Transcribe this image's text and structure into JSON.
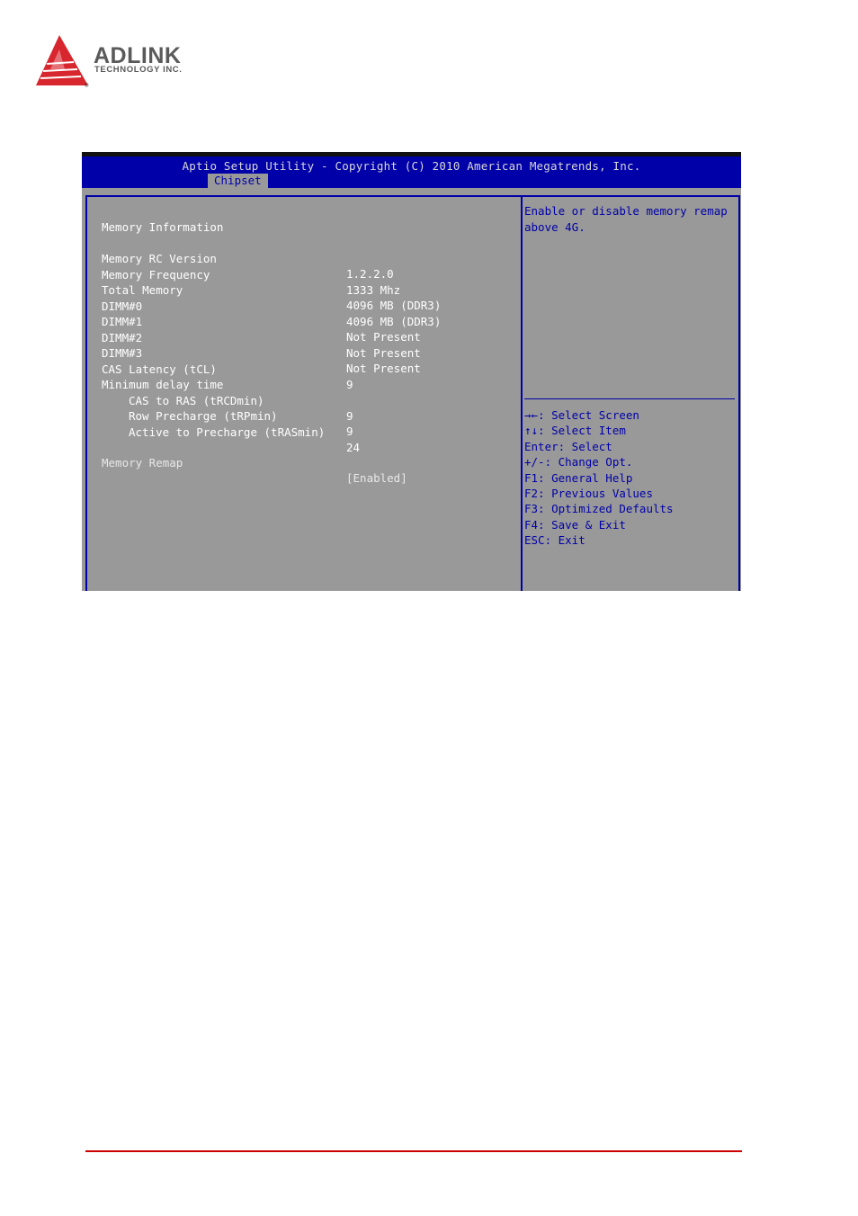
{
  "logo": {
    "name": "ADLINK",
    "subtitle": "TECHNOLOGY INC.",
    "registered": "®",
    "brand_color": "#d7262e"
  },
  "bios": {
    "title": "Aptio Setup Utility - Copyright (C) 2010 American Megatrends, Inc.",
    "active_tab": "Chipset",
    "colors": {
      "header": "#0000a8",
      "panel": "#999999",
      "text": "#ffffff",
      "help_text": "#0000a8"
    },
    "section_title": "Memory Information",
    "rows": [
      {
        "label": "Memory RC Version",
        "value": "1.2.2.0"
      },
      {
        "label": "Memory Frequency",
        "value": "1333 Mhz"
      },
      {
        "label": "Total Memory",
        "value": "4096 MB (DDR3)"
      },
      {
        "label": "DIMM#0",
        "value": "4096 MB (DDR3)"
      },
      {
        "label": "DIMM#1",
        "value": "Not Present"
      },
      {
        "label": "DIMM#2",
        "value": "Not Present"
      },
      {
        "label": "DIMM#3",
        "value": "Not Present"
      },
      {
        "label": "CAS Latency (tCL)",
        "value": "9"
      },
      {
        "label": "Minimum delay time",
        "value": ""
      },
      {
        "label": "CAS to RAS (tRCDmin)",
        "value": "9"
      },
      {
        "label": "Row Precharge (tRPmin)",
        "value": "9"
      },
      {
        "label": "Active to Precharge (tRASmin)",
        "value": "24"
      }
    ],
    "option": {
      "label": "Memory Remap",
      "value": "[Enabled]"
    },
    "help_text": "Enable or disable memory remap above 4G.",
    "keys": [
      "→←: Select Screen",
      "↑↓: Select Item",
      "Enter: Select",
      "+/-: Change Opt.",
      "F1: General Help",
      "F2: Previous Values",
      "F3: Optimized Defaults",
      "F4: Save & Exit",
      "ESC: Exit"
    ]
  }
}
